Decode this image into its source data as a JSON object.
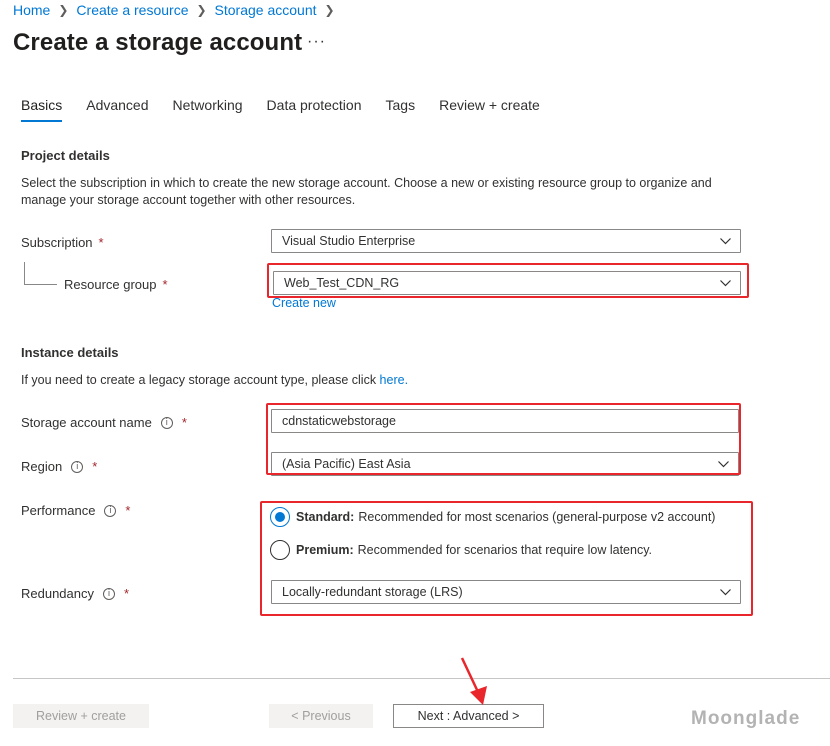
{
  "breadcrumb": {
    "items": [
      "Home",
      "Create a resource",
      "Storage account"
    ]
  },
  "page": {
    "title": "Create a storage account",
    "more": "···"
  },
  "tabs": [
    {
      "label": "Basics",
      "active": true
    },
    {
      "label": "Advanced"
    },
    {
      "label": "Networking"
    },
    {
      "label": "Data protection"
    },
    {
      "label": "Tags"
    },
    {
      "label": "Review + create"
    }
  ],
  "project": {
    "title": "Project details",
    "description": "Select the subscription in which to create the new storage account. Choose a new or existing resource group to organize and manage your storage account together with other resources.",
    "subscription_label": "Subscription",
    "subscription_value": "Visual Studio Enterprise",
    "resource_group_label": "Resource group",
    "resource_group_value": "Web_Test_CDN_RG",
    "create_new": "Create new"
  },
  "instance": {
    "title": "Instance details",
    "description": "If you need to create a legacy storage account type, please click ",
    "description_link": "here.",
    "name_label": "Storage account name",
    "name_value": "cdnstaticwebstorage",
    "region_label": "Region",
    "region_value": "(Asia Pacific) East Asia",
    "performance_label": "Performance",
    "standard_title": "Standard:",
    "standard_desc": "Recommended for most scenarios (general-purpose v2 account)",
    "premium_title": "Premium:",
    "premium_desc": "Recommended for scenarios that require low latency.",
    "redundancy_label": "Redundancy",
    "redundancy_value": "Locally-redundant storage (LRS)"
  },
  "required_mark": "*",
  "info_glyph": "i",
  "footer": {
    "review_create": "Review + create",
    "previous": "< Previous",
    "next": "Next : Advanced >"
  },
  "watermark": "Moonglade",
  "colors": {
    "accent": "#0078d4",
    "highlight": "#e8262b",
    "required": "#a4262c"
  }
}
